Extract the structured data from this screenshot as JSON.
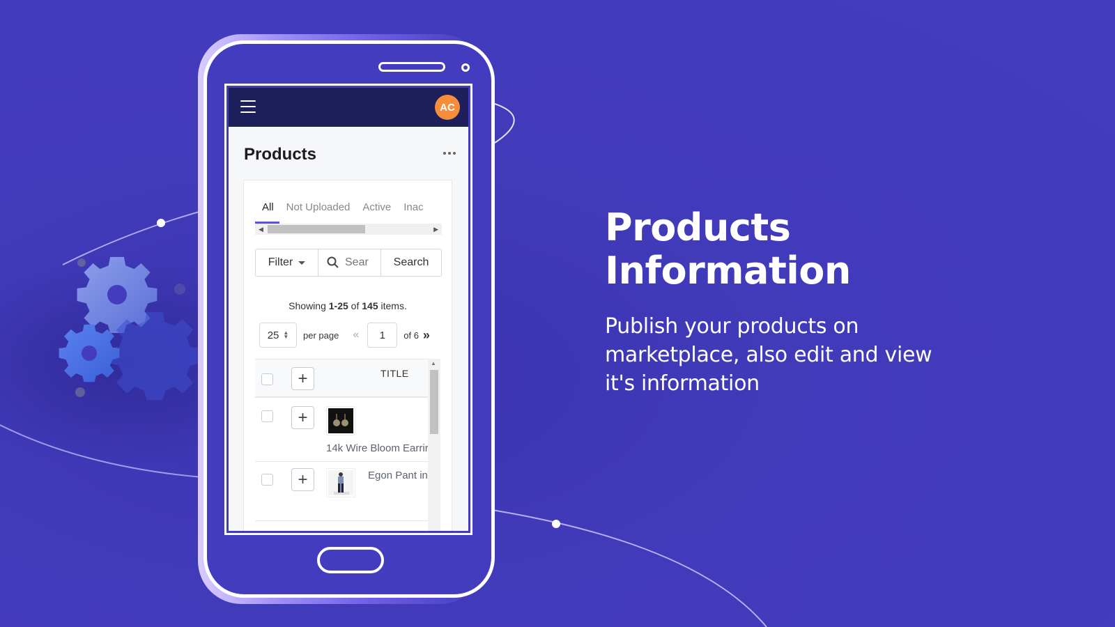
{
  "app": {
    "avatar_initials": "AC",
    "page_title": "Products",
    "tabs": [
      {
        "label": "All",
        "active": true
      },
      {
        "label": "Not Uploaded",
        "active": false
      },
      {
        "label": "Active",
        "active": false
      },
      {
        "label": "Inac",
        "active": false
      }
    ],
    "filter": {
      "filter_label": "Filter",
      "search_placeholder": "Sear",
      "search_button": "Search"
    },
    "summary": {
      "prefix": "Showing ",
      "range": "1-25",
      "middle": " of ",
      "total": "145",
      "suffix": " items."
    },
    "pagination": {
      "per_page_value": "25",
      "per_page_label": "per page",
      "prev_symbol": "«",
      "current_page": "1",
      "of_label": "of 6",
      "next_symbol": "»"
    },
    "table": {
      "columns": [
        "TITLE"
      ],
      "rows": [
        {
          "title": "14k Wire Bloom Earrir",
          "image": "earrings-thumbnail"
        },
        {
          "title": "Egon Pant in",
          "image": "pants-model-thumbnail"
        }
      ]
    }
  },
  "hero": {
    "title_line1": "Products",
    "title_line2": "Information",
    "subtitle": "Publish your products on marketplace, also edit and view it's information"
  },
  "colors": {
    "background": "#433cbf",
    "topbar": "#1d1f5b",
    "avatar": "#f58d3c",
    "tab_indicator": "#5a55c8"
  }
}
